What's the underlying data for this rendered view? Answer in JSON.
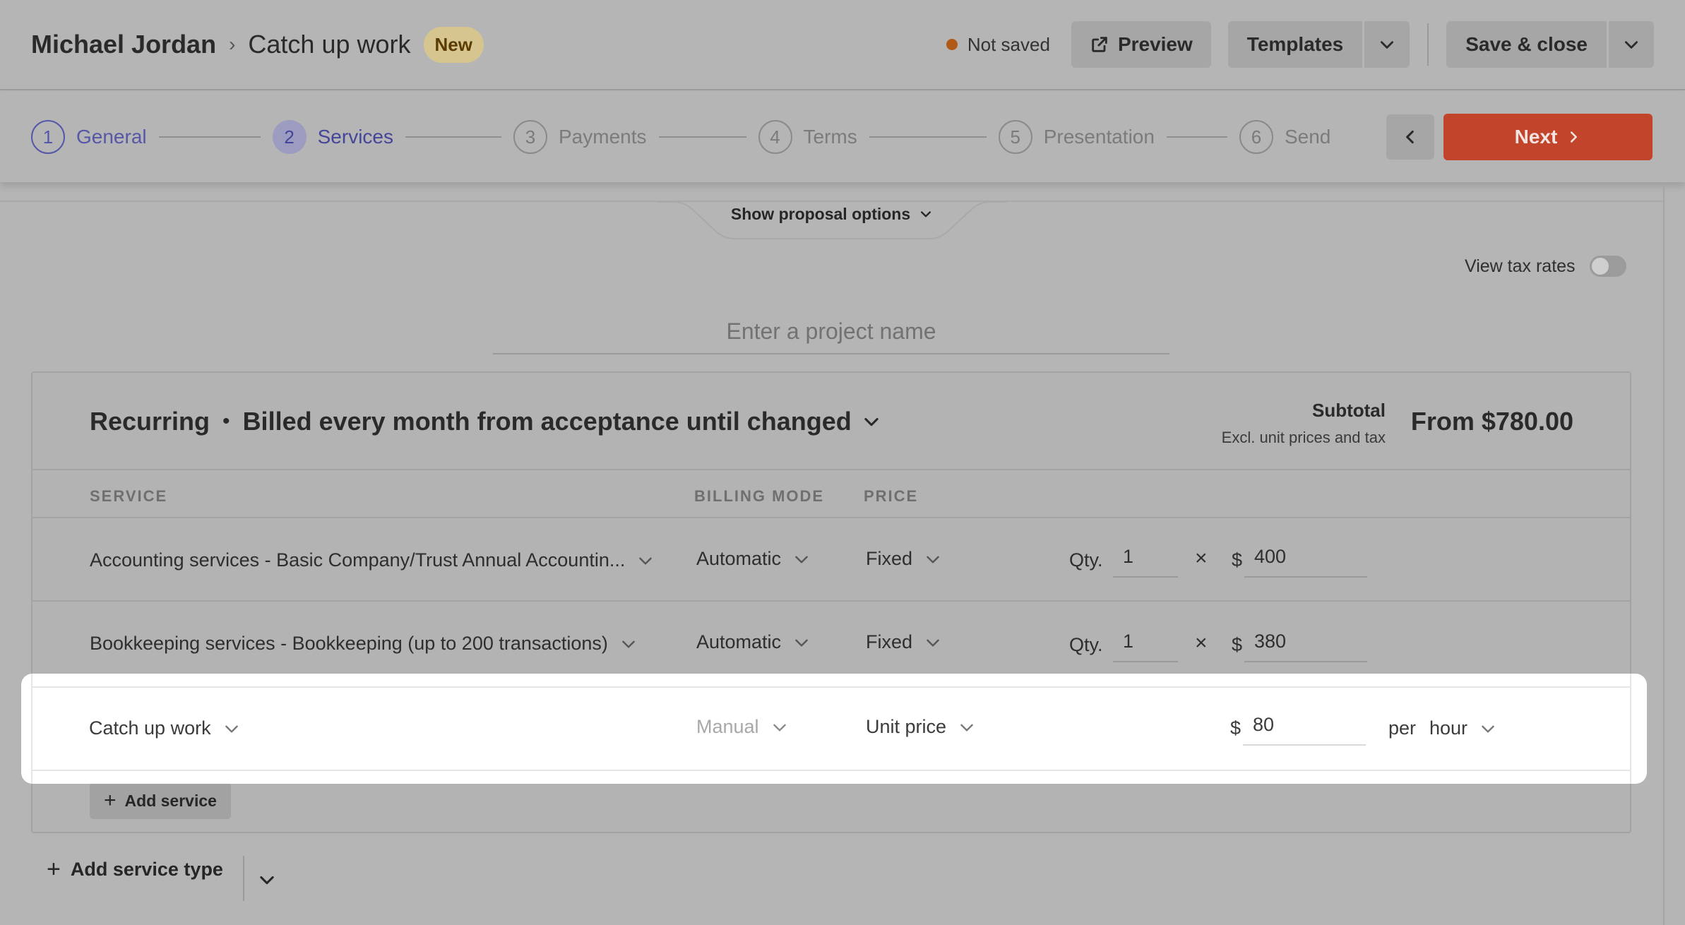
{
  "header": {
    "client": "Michael Jordan",
    "separator": "›",
    "page_title": "Catch up work",
    "badge": "New",
    "save_status": "Not saved",
    "preview_label": "Preview",
    "templates_label": "Templates",
    "save_close_label": "Save & close"
  },
  "stepper": {
    "steps": [
      {
        "num": "1",
        "label": "General"
      },
      {
        "num": "2",
        "label": "Services"
      },
      {
        "num": "3",
        "label": "Payments"
      },
      {
        "num": "4",
        "label": "Terms"
      },
      {
        "num": "5",
        "label": "Presentation"
      },
      {
        "num": "6",
        "label": "Send"
      }
    ],
    "next_label": "Next"
  },
  "options": {
    "show_label": "Show proposal options",
    "tax_label": "View tax rates"
  },
  "project": {
    "placeholder": "Enter a project name"
  },
  "card": {
    "kind": "Recurring",
    "dot": "•",
    "schedule": "Billed every month from acceptance until changed",
    "subtotal_label": "Subtotal",
    "subtotal_note": "Excl. unit prices and tax",
    "subtotal_amount": "From $780.00",
    "columns": {
      "service": "SERVICE",
      "billing": "BILLING MODE",
      "price": "PRICE"
    },
    "rows": [
      {
        "service": "Accounting services - Basic Company/Trust Annual Accountin...",
        "billing": "Automatic",
        "price": "Fixed",
        "qty_label": "Qty.",
        "qty": "1",
        "times": "×",
        "currency": "$",
        "amount": "400"
      },
      {
        "service": "Bookkeeping services - Bookkeeping (up to 200 transactions)",
        "billing": "Automatic",
        "price": "Fixed",
        "qty_label": "Qty.",
        "qty": "1",
        "times": "×",
        "currency": "$",
        "amount": "380"
      },
      {
        "service": "Catch up work",
        "billing": "Manual",
        "price": "Unit price",
        "currency": "$",
        "amount": "80",
        "per": "per",
        "unit": "hour"
      }
    ],
    "add_service_label": "Add service"
  },
  "footer": {
    "add_type_label": "Add service type"
  },
  "colors": {
    "accent": "#5557a8",
    "next_button": "#c2442a",
    "status_dot": "#b15a18",
    "badge_bg": "#d6c58f"
  }
}
